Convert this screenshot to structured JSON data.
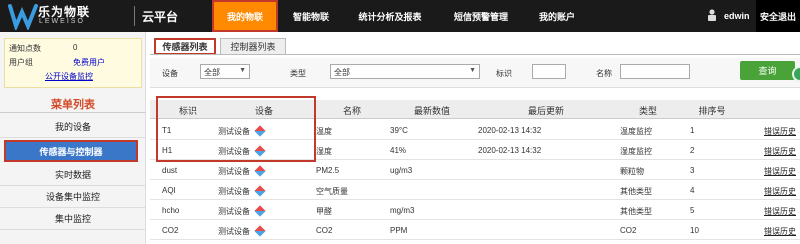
{
  "header": {
    "logo_cn": "乐为物联",
    "logo_en": "LEWEISO",
    "platform": "云平台",
    "nav": [
      "我的物联",
      "智能物联",
      "统计分析及报表",
      "短信预警管理",
      "我的账户"
    ],
    "active_nav": "我的物联",
    "username": "edwin",
    "logout": "安全退出"
  },
  "sidebar": {
    "info": {
      "points_label": "通知点数",
      "points_value": "0",
      "group_label": "用户组",
      "group_value": "免费用户",
      "public_link": "公开设备监控"
    },
    "menu_title": "菜单列表",
    "items": [
      "我的设备",
      "传感器与控制器",
      "实时数据",
      "设备集中监控",
      "集中监控"
    ],
    "active_item": "传感器与控制器"
  },
  "tabs": [
    "传感器列表",
    "控制器列表"
  ],
  "filter": {
    "device_label": "设备",
    "device_value": "全部",
    "type_label": "类型",
    "type_value": "全部",
    "tag_label": "标识",
    "tag_value": "",
    "name_label": "名称",
    "name_value": "",
    "query_button": "查询"
  },
  "table": {
    "columns": [
      "标识",
      "设备",
      "名称",
      "最新数值",
      "最后更新",
      "类型",
      "排序号"
    ],
    "rows": [
      {
        "tag": "T1",
        "device": "测试设备",
        "name": "温度",
        "value": "39°C",
        "updated": "2020-02-13 14:32",
        "type": "温度监控",
        "order": "1",
        "action": "错误历史"
      },
      {
        "tag": "H1",
        "device": "测试设备",
        "name": "湿度",
        "value": "41%",
        "updated": "2020-02-13 14:32",
        "type": "湿度监控",
        "order": "2",
        "action": "错误历史"
      },
      {
        "tag": "dust",
        "device": "测试设备",
        "name": "PM2.5",
        "value": "ug/m3",
        "updated": "",
        "type": "颗粒物",
        "order": "3",
        "action": "错误历史"
      },
      {
        "tag": "AQI",
        "device": "测试设备",
        "name": "空气质量",
        "value": "",
        "updated": "",
        "type": "其他类型",
        "order": "4",
        "action": "错误历史"
      },
      {
        "tag": "hcho",
        "device": "测试设备",
        "name": "甲醛",
        "value": "mg/m3",
        "updated": "",
        "type": "其他类型",
        "order": "5",
        "action": "错误历史"
      },
      {
        "tag": "CO2",
        "device": "测试设备",
        "name": "CO2",
        "value": "PPM",
        "updated": "",
        "type": "CO2",
        "order": "10",
        "action": "错误历史"
      }
    ]
  },
  "colors": {
    "accent_orange": "#ff8a00",
    "active_blue": "#3a77c9",
    "query_green": "#49a338",
    "highlight_red": "#c0392b"
  }
}
